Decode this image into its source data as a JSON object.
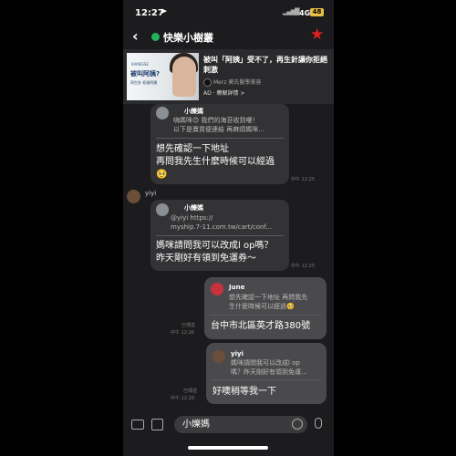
{
  "status_bar": {
    "time": "12:27",
    "location_icon": "navigation-arrow-icon",
    "network": "4G",
    "battery": "48"
  },
  "header": {
    "back_icon": "chevron-left-icon",
    "chat_name": "快樂小樹叢",
    "star_icon": "star-icon",
    "star_color": "#e02020"
  },
  "ad": {
    "image_brand": "KAMESSE",
    "image_headline": "被叫阿姨?",
    "image_sub": "再生針 拒絕阿姨",
    "title": "被叫「阿姨」受不了，再生針讓你拒絕刺激",
    "source": "Merz 莫氏醫學美容",
    "more": "AD · 瞭解詳情 >"
  },
  "messages": [
    {
      "side": "left",
      "quote_name": "小爍媽",
      "quote_text": "嗨媽咪😊 我們的海苔收到嘍！\n以下是賣貨便連結 再麻煩媽咪...",
      "text": "想先確認一下地址\n再問我先生什麼時候可以經過\n🥺",
      "time": "中午 12:25"
    },
    {
      "side": "left",
      "sender": "yiyi",
      "quote_name": "小爍媽",
      "quote_text": "@yiyi https://\nmyship.7-11.com.tw/cart/conf...",
      "text": "媽咪請問我可以改成l op嗎？\n昨天剛好有領到免運券～",
      "time": "中午 12:25"
    },
    {
      "side": "right",
      "quote_name": "June",
      "quote_text": "想先確認一下地址 再問我先\n生什麼時候可以經過🥺",
      "text": "台中市北區英才路380號",
      "read": "已傳送",
      "time": "中午 12:26"
    },
    {
      "side": "right",
      "quote_name": "yiyi",
      "quote_text": "媽咪請問我可以改成l op\n嗎？昨天剛好有領到免運...",
      "text": "好噢稍等我一下",
      "read": "已傳送",
      "time": "中午 12:28"
    }
  ],
  "input_bar": {
    "camera_icon": "camera-icon",
    "image_icon": "image-icon",
    "value": "小爍媽",
    "emoji_icon": "emoji-icon",
    "mic_icon": "microphone-icon"
  }
}
